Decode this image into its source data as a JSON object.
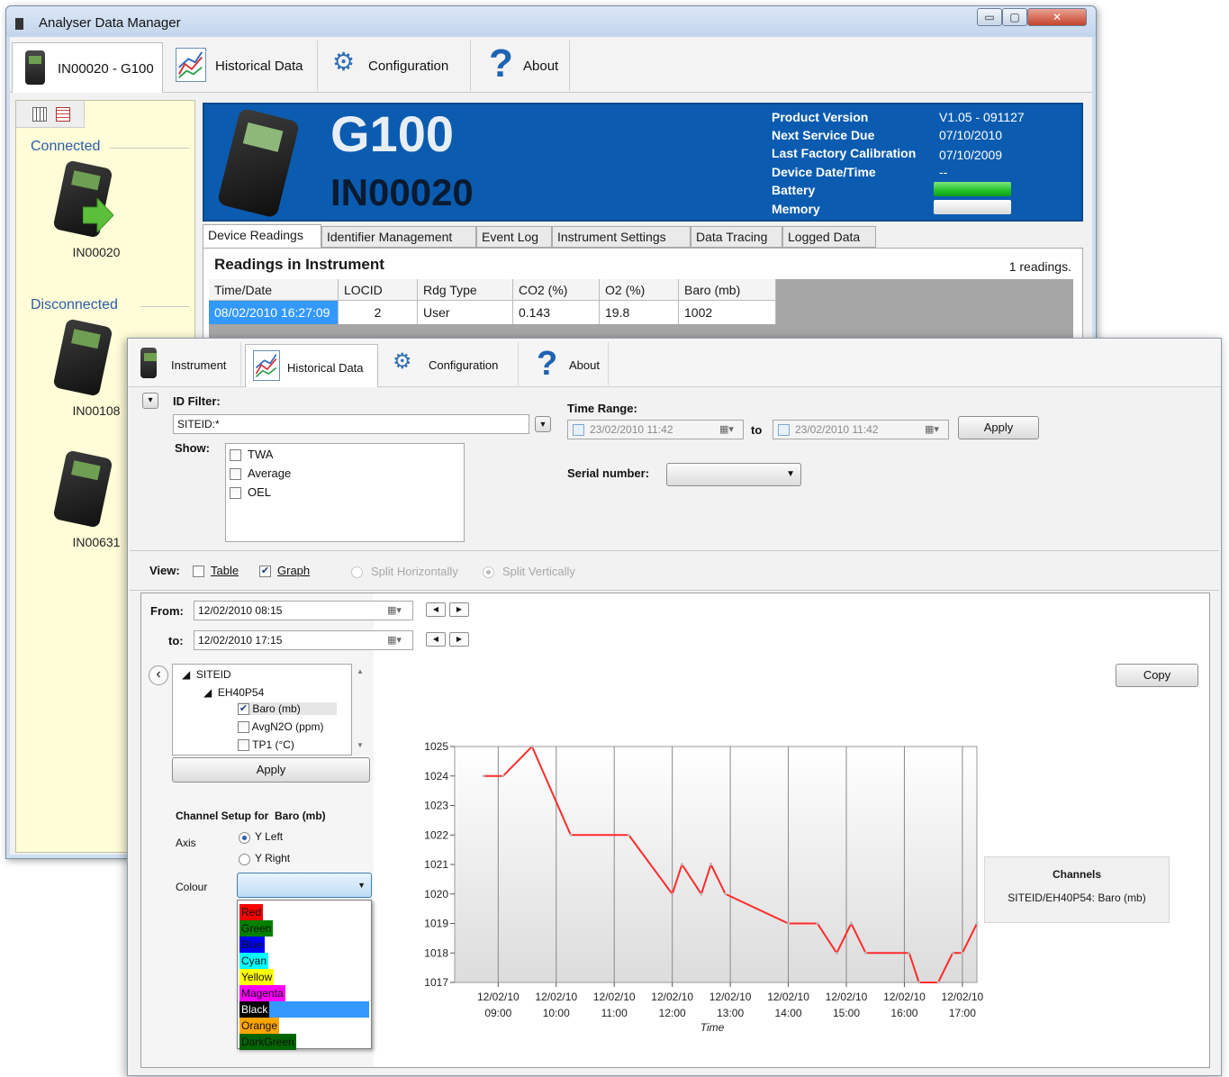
{
  "back_window": {
    "title": "Analyser Data Manager",
    "caption_buttons": {
      "minimize": "▭",
      "maximize": "▢",
      "close": "✕"
    },
    "tabs": [
      {
        "label": "IN00020 - G100",
        "icon": "device-icon"
      },
      {
        "label": "Historical Data",
        "icon": "graph-icon"
      },
      {
        "label": "Configuration",
        "icon": "gear-icon"
      },
      {
        "label": "About",
        "icon": "question-icon"
      }
    ],
    "sidebar": {
      "connected_label": "Connected",
      "disconnected_label": "Disconnected",
      "connected": [
        {
          "name": "IN00020"
        }
      ],
      "disconnected": [
        {
          "name": "IN00108"
        },
        {
          "name": "IN00631"
        }
      ]
    },
    "banner": {
      "model": "G100",
      "serial": "IN00020",
      "info": [
        {
          "label": "Product Version",
          "value": "V1.05 - 091127"
        },
        {
          "label": "Next Service Due",
          "value": "07/10/2010"
        },
        {
          "label": "Last Factory Calibration",
          "value": "07/10/2009"
        },
        {
          "label": "Device Date/Time",
          "value": "--"
        },
        {
          "label": "Battery",
          "value": ""
        },
        {
          "label": "Memory",
          "value": ""
        }
      ],
      "battery_color": "#22c32a",
      "memory_color": "#d9d9d9"
    },
    "subtabs": [
      "Device Readings",
      "Identifier Management",
      "Event Log",
      "Instrument Settings",
      "Data Tracing",
      "Logged Data"
    ],
    "readings": {
      "title": "Readings in Instrument",
      "count_text": "1 readings.",
      "columns": [
        "Time/Date",
        "LOCID",
        "Rdg Type",
        "CO2 (%)",
        "O2 (%)",
        "Baro (mb)"
      ],
      "row": [
        "08/02/2010 16:27:09",
        "2",
        "User",
        "0.143",
        "19.8",
        "1002"
      ]
    }
  },
  "front_window": {
    "tabs": [
      {
        "label": "Instrument",
        "icon": "device-icon"
      },
      {
        "label": "Historical Data",
        "icon": "graph-icon"
      },
      {
        "label": "Configuration",
        "icon": "gear-icon"
      },
      {
        "label": "About",
        "icon": "question-icon"
      }
    ],
    "filter": {
      "collapse_glyph": "▾",
      "id_filter_label": "ID Filter:",
      "id_filter_value": "SITEID:*",
      "show_label": "Show:",
      "show_options": [
        "TWA",
        "Average",
        "OEL"
      ],
      "time_range_label": "Time Range:",
      "time_from": "23/02/2010 11:42",
      "time_to_word": "to",
      "time_to": "23/02/2010 11:42",
      "apply_label": "Apply",
      "serial_label": "Serial number:",
      "serial_value": ""
    },
    "view": {
      "label": "View:",
      "table_label": "Table",
      "table_checked": false,
      "graph_label": "Graph",
      "graph_checked": true,
      "split_h": "Split Horizontally",
      "split_v": "Split Vertically"
    },
    "graph_panel": {
      "from_label": "From:",
      "from_value": "12/02/2010 08:15",
      "to_label": "to:",
      "to_value": "12/02/2010 17:15",
      "back_glyph": "‹",
      "tree": [
        {
          "text": "SITEID",
          "level": 0,
          "checkbox": false
        },
        {
          "text": "EH40P54",
          "level": 1,
          "checkbox": false
        },
        {
          "text": "Baro (mb)",
          "level": 2,
          "checkbox": true,
          "checked": true
        },
        {
          "text": "AvgN2O (ppm)",
          "level": 2,
          "checkbox": true,
          "checked": false
        },
        {
          "text": "TP1 (°C)",
          "level": 2,
          "checkbox": true,
          "checked": false
        }
      ],
      "tree_apply": "Apply",
      "channel_setup_label": "Channel Setup for",
      "channel_name": "Baro (mb)",
      "axis_label": "Axis",
      "axis_left": "Y Left",
      "axis_right": "Y Right",
      "colour_label": "Colour",
      "colour_options": [
        {
          "name": "Red",
          "color": "#ff0000",
          "text": "#111111"
        },
        {
          "name": "Green",
          "color": "#008000",
          "text": "#111111"
        },
        {
          "name": "Blue",
          "color": "#0000ff",
          "text": "#111111"
        },
        {
          "name": "Cyan",
          "color": "#00ffff",
          "text": "#111111"
        },
        {
          "name": "Yellow",
          "color": "#ffff00",
          "text": "#111111"
        },
        {
          "name": "Magenta",
          "color": "#ff00ff",
          "text": "#111111"
        },
        {
          "name": "Black",
          "color": "#000000",
          "text": "#ffffff",
          "selected": true
        },
        {
          "name": "Orange",
          "color": "#ffa500",
          "text": "#111111"
        },
        {
          "name": "DarkGreen",
          "color": "#006400",
          "text": "#111111"
        }
      ],
      "copy_label": "Copy",
      "legend_title": "Channels",
      "legend_item": "SITEID/EH40P54: Baro (mb)"
    }
  },
  "chart_data": {
    "type": "line",
    "xlabel": "Time",
    "ylabel": "",
    "x_range": [
      "12/02/2010 08:15",
      "12/02/2010 17:15"
    ],
    "x_ticks": [
      "12/02/10 09:00",
      "12/02/10 10:00",
      "12/02/10 11:00",
      "12/02/10 12:00",
      "12/02/10 13:00",
      "12/02/10 14:00",
      "12/02/10 15:00",
      "12/02/10 16:00",
      "12/02/10 17:00"
    ],
    "ylim": [
      1017,
      1025
    ],
    "y_ticks": [
      1017,
      1018,
      1019,
      1020,
      1021,
      1022,
      1023,
      1024,
      1025
    ],
    "grid": "vertical",
    "series": [
      {
        "name": "SITEID/EH40P54: Baro (mb)",
        "color": "#ff2b2b",
        "points": [
          [
            "12/02/2010 08:45",
            1024
          ],
          [
            "12/02/2010 09:05",
            1024
          ],
          [
            "12/02/2010 09:35",
            1025
          ],
          [
            "12/02/2010 10:15",
            1022
          ],
          [
            "12/02/2010 11:15",
            1022
          ],
          [
            "12/02/2010 12:00",
            1020
          ],
          [
            "12/02/2010 12:10",
            1021
          ],
          [
            "12/02/2010 12:30",
            1020
          ],
          [
            "12/02/2010 12:40",
            1021
          ],
          [
            "12/02/2010 12:55",
            1020
          ],
          [
            "12/02/2010 14:00",
            1019
          ],
          [
            "12/02/2010 14:30",
            1019
          ],
          [
            "12/02/2010 14:50",
            1018
          ],
          [
            "12/02/2010 15:05",
            1019
          ],
          [
            "12/02/2010 15:20",
            1018
          ],
          [
            "12/02/2010 16:05",
            1018
          ],
          [
            "12/02/2010 16:15",
            1017
          ],
          [
            "12/02/2010 16:35",
            1017
          ],
          [
            "12/02/2010 16:50",
            1018
          ],
          [
            "12/02/2010 17:00",
            1018
          ],
          [
            "12/02/2010 17:15",
            1019
          ]
        ]
      }
    ],
    "legend": "right"
  }
}
